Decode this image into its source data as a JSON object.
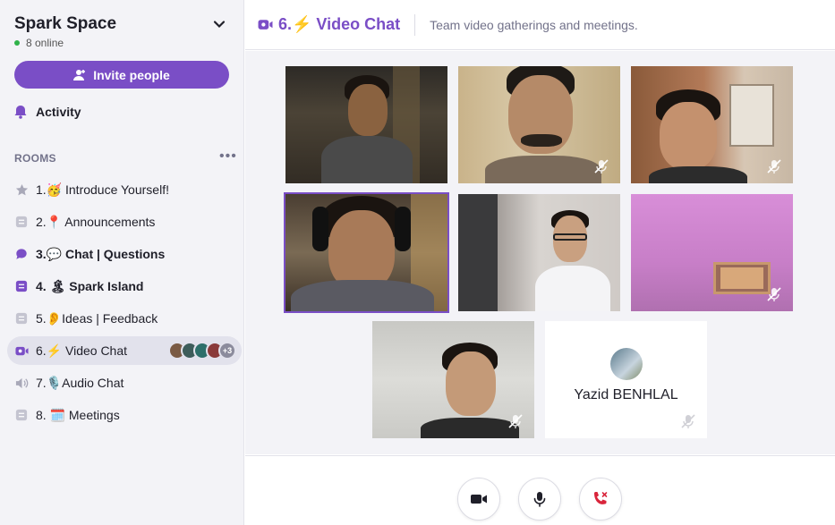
{
  "workspace": {
    "name": "Spark Space",
    "online": "8 online",
    "invite_label": "Invite people"
  },
  "nav": {
    "activity_label": "Activity"
  },
  "rooms": {
    "heading": "ROOMS",
    "items": [
      {
        "label": "1.🥳 Introduce Yourself!",
        "icon": "star-icon",
        "bold": false
      },
      {
        "label": "2.📍 Announcements",
        "icon": "text-channel-icon",
        "bold": false
      },
      {
        "label": "3.💬 Chat | Questions",
        "icon": "chat-bubble-icon",
        "bold": true
      },
      {
        "label": "4. 🏝 Spark Island",
        "icon": "text-channel-icon",
        "bold": true
      },
      {
        "label": "5.👂Ideas | Feedback",
        "icon": "text-channel-icon",
        "bold": false
      },
      {
        "label": "6.⚡ Video Chat",
        "icon": "video-room-icon",
        "bold": false,
        "participants_more": "+3"
      },
      {
        "label": "7.🎙️Audio Chat",
        "icon": "speaker-icon",
        "bold": false
      },
      {
        "label": "8. 🗓️ Meetings",
        "icon": "text-channel-icon",
        "bold": false
      }
    ]
  },
  "header": {
    "title": "6.⚡ Video Chat",
    "description": "Team video gatherings and meetings."
  },
  "participants": [
    {
      "id": "p1",
      "muted": false
    },
    {
      "id": "p2",
      "muted": true
    },
    {
      "id": "p3",
      "muted": true
    },
    {
      "id": "p4",
      "muted": false,
      "speaking": true
    },
    {
      "id": "p5",
      "muted": false
    },
    {
      "id": "p6",
      "muted": true
    },
    {
      "id": "p7",
      "muted": true
    },
    {
      "id": "p8",
      "name": "Yazid BENHLAL",
      "muted": true,
      "video_off": true
    }
  ],
  "colors": {
    "accent": "#7a4ec6",
    "sidebar_bg": "#f3f3f7",
    "hangup": "#d9253b"
  }
}
